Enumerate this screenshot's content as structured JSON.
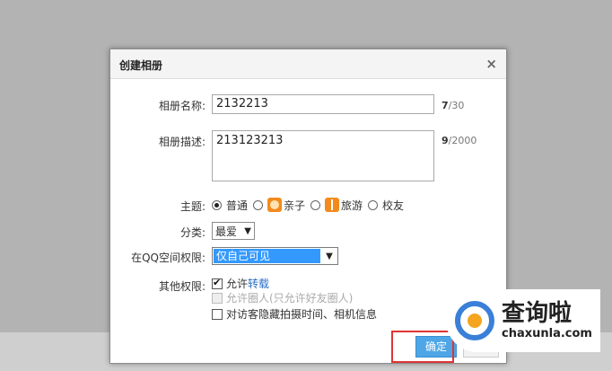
{
  "dialog": {
    "title": "创建相册",
    "close_glyph": "×"
  },
  "form": {
    "name_label": "相册名称:",
    "name_value": "2132213",
    "name_count": "7",
    "name_max": "/30",
    "desc_label": "相册描述:",
    "desc_value": "213123213",
    "desc_count": "9",
    "desc_max": "/2000",
    "theme_label": "主题:",
    "theme_options": [
      {
        "label": "普通",
        "checked": true
      },
      {
        "label": "亲子",
        "checked": false,
        "icon": "kid-icon"
      },
      {
        "label": "旅游",
        "checked": false,
        "icon": "travel-icon"
      },
      {
        "label": "校友",
        "checked": false
      }
    ],
    "category_label": "分类:",
    "category_value": "最爱",
    "permission_label": "在QQ空间权限:",
    "permission_value": "仅自己可见",
    "other_label": "其他权限:",
    "allow_prefix": "允许",
    "allow_link": "转载",
    "allow_circle": "允许圈人(只允许好友圈人)",
    "hide_info": "对访客隐藏拍摄时间、相机信息"
  },
  "buttons": {
    "ok": "确定"
  },
  "watermark": {
    "cn": "查询啦",
    "en": "chaxunla.com"
  },
  "colors": {
    "accent": "#4ea6e6",
    "highlight": "#e03434",
    "select_highlight": "#3399ff"
  }
}
